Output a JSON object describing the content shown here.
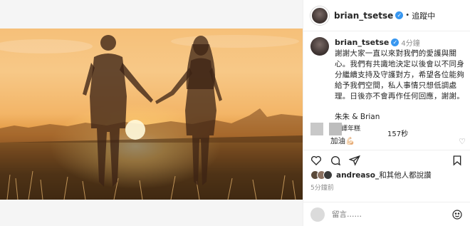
{
  "header": {
    "username": "brian_tsetse",
    "separator": "•",
    "follow_label": "追蹤中"
  },
  "caption": {
    "username": "brian_tsetse",
    "time": "4分鐘",
    "text": "謝謝大家一直以來對我們的愛護與關心。我們有共識地決定以後會以不同身分繼續支持及守護對方，希望各位能夠給予我們空間，私人事情只想低調處理。日後亦不會再作任何回應，謝謝。",
    "signature": "朱朱 & Brian",
    "translate_label": "翻譯年糕"
  },
  "comment": {
    "meta": "157秒",
    "text": "加油💪🏻"
  },
  "likes": {
    "username": "andreaso_",
    "suffix": "和其他人都說讚"
  },
  "posted": "5分鐘前",
  "add_comment": {
    "placeholder": "留言……"
  },
  "colors": {
    "verified": "#3897f0",
    "border": "#efefef",
    "muted": "#8e8e8e"
  },
  "icons": {
    "like": "heart-icon",
    "comment": "comment-bubble-icon",
    "share": "paper-plane-icon",
    "save": "bookmark-icon",
    "emoji": "smiley-icon"
  }
}
